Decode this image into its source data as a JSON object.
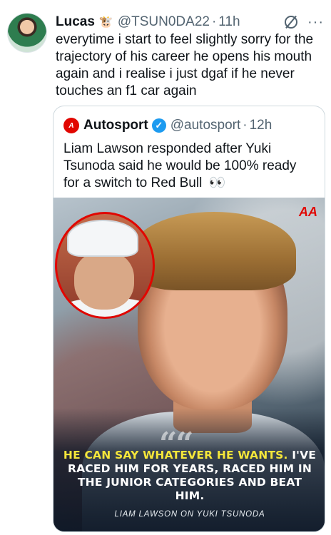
{
  "tweet": {
    "author_name": "Lucas",
    "author_emoji": "🐮",
    "handle": "@TSUN0DA22",
    "separator": "·",
    "time": "11h",
    "text": "everytime i start to feel slightly sorry for the trajectory of his career he opens his mouth again and i realise i just dgaf if he never touches an f1 car again",
    "more_icon": "···"
  },
  "quote": {
    "logo_text": "A",
    "author_name": "Autosport",
    "verified_mark": "✓",
    "handle": "@autosport",
    "separator": "·",
    "time": "12h",
    "text": "Liam Lawson responded after Yuki Tsunoda said he would be 100% ready for a switch to Red Bull",
    "eyes": "👀",
    "media": {
      "brand_logo": "AA",
      "quote_mark": "““",
      "caption_highlight": "HE CAN SAY WHATEVER HE WANTS.",
      "caption_rest": " I'VE RACED HIM FOR YEARS, RACED HIM IN THE JUNIOR CATEGORIES AND BEAT HIM.",
      "attribution": "LIAM LAWSON ON YUKI TSUNODA"
    }
  }
}
